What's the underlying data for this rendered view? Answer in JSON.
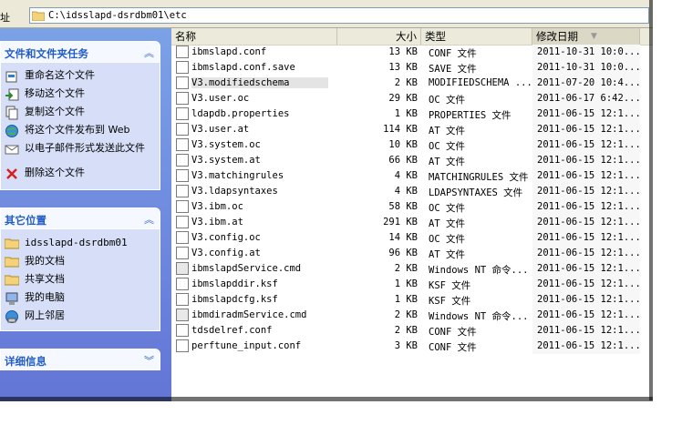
{
  "address": {
    "label": "址",
    "path": "C:\\idsslapd-dsrdbm01\\etc"
  },
  "task_panel": {
    "title": "文件和文件夹任务",
    "items": [
      {
        "label": "重命名这个文件",
        "icon": "rename-icon"
      },
      {
        "label": "移动这个文件",
        "icon": "move-icon"
      },
      {
        "label": "复制这个文件",
        "icon": "copy-icon"
      },
      {
        "label": "将这个文件发布到 Web",
        "icon": "web-publish-icon"
      },
      {
        "label": "以电子邮件形式发送此文件",
        "icon": "email-icon"
      },
      {
        "label": "删除这个文件",
        "icon": "delete-icon"
      }
    ]
  },
  "places_panel": {
    "title": "其它位置",
    "items": [
      {
        "label": "idsslapd-dsrdbm01",
        "icon": "folder-icon"
      },
      {
        "label": "我的文档",
        "icon": "folder-icon"
      },
      {
        "label": "共享文档",
        "icon": "folder-icon"
      },
      {
        "label": "我的电脑",
        "icon": "computer-icon"
      },
      {
        "label": "网上邻居",
        "icon": "network-icon"
      }
    ]
  },
  "details_panel": {
    "title": "详细信息"
  },
  "columns": {
    "name": "名称",
    "size": "大小",
    "type": "类型",
    "modified": "修改日期"
  },
  "files": [
    {
      "name": "ibmslapd.conf",
      "size": "13 KB",
      "type": "CONF 文件",
      "date": "2011-10-31 10:0..."
    },
    {
      "name": "ibmslapd.conf.save",
      "size": "13 KB",
      "type": "SAVE 文件",
      "date": "2011-10-31 10:0..."
    },
    {
      "name": "V3.modifiedschema",
      "size": "2 KB",
      "type": "MODIFIEDSCHEMA ...",
      "date": "2011-07-20 10:4..."
    },
    {
      "name": "V3.user.oc",
      "size": "29 KB",
      "type": "OC 文件",
      "date": "2011-06-17 6:42..."
    },
    {
      "name": "ldapdb.properties",
      "size": "1 KB",
      "type": "PROPERTIES 文件",
      "date": "2011-06-15 12:1..."
    },
    {
      "name": "V3.user.at",
      "size": "114 KB",
      "type": "AT 文件",
      "date": "2011-06-15 12:1..."
    },
    {
      "name": "V3.system.oc",
      "size": "10 KB",
      "type": "OC 文件",
      "date": "2011-06-15 12:1..."
    },
    {
      "name": "V3.system.at",
      "size": "66 KB",
      "type": "AT 文件",
      "date": "2011-06-15 12:1..."
    },
    {
      "name": "V3.matchingrules",
      "size": "4 KB",
      "type": "MATCHINGRULES 文件",
      "date": "2011-06-15 12:1..."
    },
    {
      "name": "V3.ldapsyntaxes",
      "size": "4 KB",
      "type": "LDAPSYNTAXES 文件",
      "date": "2011-06-15 12:1..."
    },
    {
      "name": "V3.ibm.oc",
      "size": "58 KB",
      "type": "OC 文件",
      "date": "2011-06-15 12:1..."
    },
    {
      "name": "V3.ibm.at",
      "size": "291 KB",
      "type": "AT 文件",
      "date": "2011-06-15 12:1..."
    },
    {
      "name": "V3.config.oc",
      "size": "14 KB",
      "type": "OC 文件",
      "date": "2011-06-15 12:1..."
    },
    {
      "name": "V3.config.at",
      "size": "96 KB",
      "type": "AT 文件",
      "date": "2011-06-15 12:1..."
    },
    {
      "name": "ibmslapdService.cmd",
      "size": "2 KB",
      "type": "Windows NT 命令...",
      "date": "2011-06-15 12:1..."
    },
    {
      "name": "ibmslapddir.ksf",
      "size": "1 KB",
      "type": "KSF 文件",
      "date": "2011-06-15 12:1..."
    },
    {
      "name": "ibmslapdcfg.ksf",
      "size": "1 KB",
      "type": "KSF 文件",
      "date": "2011-06-15 12:1..."
    },
    {
      "name": "ibmdiradmService.cmd",
      "size": "2 KB",
      "type": "Windows NT 命令...",
      "date": "2011-06-15 12:1..."
    },
    {
      "name": "tdsdelref.conf",
      "size": "2 KB",
      "type": "CONF 文件",
      "date": "2011-06-15 12:1..."
    },
    {
      "name": "perftune_input.conf",
      "size": "3 KB",
      "type": "CONF 文件",
      "date": "2011-06-15 12:1..."
    }
  ],
  "selected_file": "V3.modifiedschema",
  "colors": {
    "taskpane_head_text": "#215dc6",
    "taskpane_bg": "#7ba2e7",
    "panel_body": "#d6dff7",
    "header_bg": "#ebeadb"
  }
}
